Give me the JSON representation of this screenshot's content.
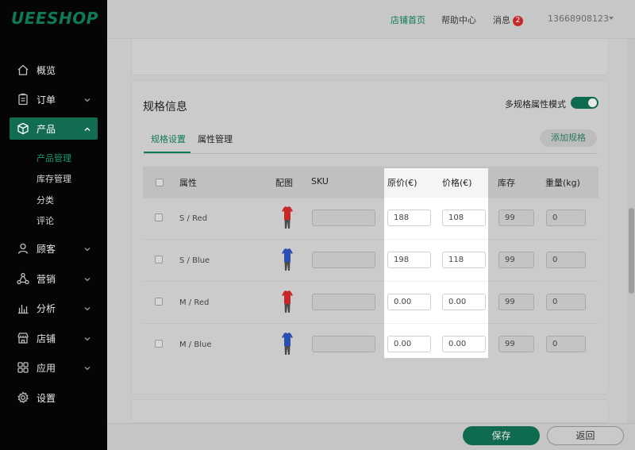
{
  "app": {
    "logo": "UEESHOP"
  },
  "topbar": {
    "store_home": "店铺首页",
    "help_center": "帮助中心",
    "messages": "消息",
    "message_count": "2",
    "user": "13668908123"
  },
  "sidebar": {
    "items": [
      {
        "label": "概览",
        "icon": "home-icon"
      },
      {
        "label": "订单",
        "icon": "clipboard-icon"
      },
      {
        "label": "产品",
        "icon": "cube-icon",
        "active": true
      },
      {
        "label": "顾客",
        "icon": "user-icon"
      },
      {
        "label": "营销",
        "icon": "share-icon"
      },
      {
        "label": "分析",
        "icon": "bar-chart-icon"
      },
      {
        "label": "店铺",
        "icon": "store-icon"
      },
      {
        "label": "应用",
        "icon": "apps-icon"
      },
      {
        "label": "设置",
        "icon": "gear-icon"
      }
    ],
    "sub_items": [
      "产品管理",
      "库存管理",
      "分类",
      "评论"
    ]
  },
  "spec": {
    "title": "规格信息",
    "mode_label": "多规格属性模式",
    "tabs": [
      "规格设置",
      "属性管理"
    ],
    "add_button": "添加规格",
    "columns": [
      "属性",
      "配图",
      "SKU",
      "原价(€)",
      "价格(€)",
      "库存",
      "重量(kg)"
    ],
    "rows": [
      {
        "attr": "S / Red",
        "sku": "",
        "orig_price": "188",
        "price": "108",
        "stock": "99",
        "weight": "0",
        "color": "red"
      },
      {
        "attr": "S / Blue",
        "sku": "",
        "orig_price": "198",
        "price": "118",
        "stock": "99",
        "weight": "0",
        "color": "blue"
      },
      {
        "attr": "M / Red",
        "sku": "",
        "orig_price": "0.00",
        "price": "0.00",
        "stock": "99",
        "weight": "0",
        "color": "red"
      },
      {
        "attr": "M / Blue",
        "sku": "",
        "orig_price": "0.00",
        "price": "0.00",
        "stock": "99",
        "weight": "0",
        "color": "blue"
      }
    ]
  },
  "footer": {
    "save": "保存",
    "back": "返回"
  },
  "colors": {
    "brand_green": "#0f7a58",
    "shirt_red": "#c62828",
    "shirt_blue": "#2a4fb0"
  }
}
